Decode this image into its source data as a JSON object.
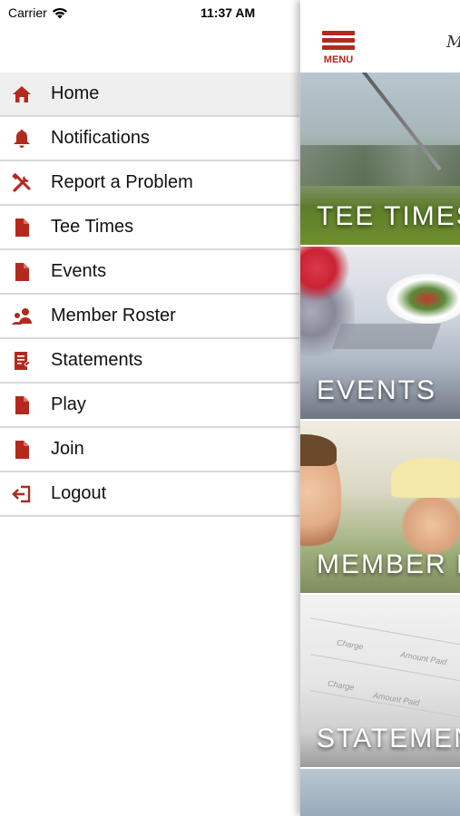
{
  "status_bar": {
    "carrier": "Carrier",
    "time": "11:37 AM",
    "icons": [
      "wifi-icon",
      "battery-icon"
    ]
  },
  "drawer": {
    "items": [
      {
        "label": "Home",
        "icon": "home-icon",
        "active": true
      },
      {
        "label": "Notifications",
        "icon": "bell-icon"
      },
      {
        "label": "Report a Problem",
        "icon": "tools-icon"
      },
      {
        "label": "Tee Times",
        "icon": "document-icon"
      },
      {
        "label": "Events",
        "icon": "document-icon"
      },
      {
        "label": "Member Roster",
        "icon": "members-icon"
      },
      {
        "label": "Statements",
        "icon": "statement-icon"
      },
      {
        "label": "Play",
        "icon": "document-icon"
      },
      {
        "label": "Join",
        "icon": "document-icon"
      },
      {
        "label": "Logout",
        "icon": "logout-icon"
      }
    ]
  },
  "main": {
    "menu_label": "MENU",
    "tiles": [
      {
        "label": "TEE TIMES"
      },
      {
        "label": "EVENTS"
      },
      {
        "label": "MEMBER R"
      },
      {
        "label": "STATEMEN"
      }
    ]
  },
  "colors": {
    "accent": "#b22a1e",
    "active_row": "#efefef",
    "divider": "#d9d9d9"
  }
}
